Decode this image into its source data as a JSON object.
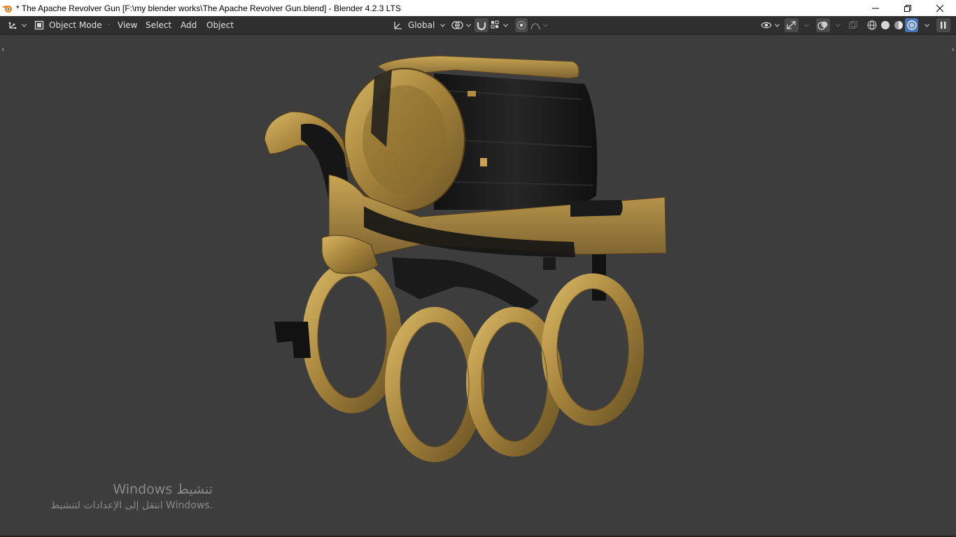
{
  "window": {
    "title": "* The Apache Revolver Gun [F:\\my blender works\\The Apache Revolver Gun.blend] - Blender 4.2.3 LTS",
    "app_icon": "blender-icon",
    "controls": [
      "minimize-icon",
      "restore-icon",
      "close-icon"
    ]
  },
  "header": {
    "editor_type_icon": "3d-viewport-icon",
    "mode": {
      "icon": "object-mode-icon",
      "label": "Object Mode"
    },
    "menus": [
      "View",
      "Select",
      "Add",
      "Object"
    ],
    "transform_orientation": {
      "icon": "global-orientation-icon",
      "label": "Global"
    },
    "pivot_icon": "pivot-point-icon",
    "snap_icon": "snap-magnet-icon",
    "snap_target_icon": "snap-increment-icon",
    "proportional_icon": "proportional-editing-icon",
    "falloff_icon": "falloff-curve-icon",
    "visibility_icon": "selectability-eye-icon",
    "gizmo_icon": "gizmo-icon",
    "overlay_icon": "overlay-icon",
    "xray_icon": "xray-icon",
    "shading_modes": [
      {
        "icon": "wireframe-shading-icon",
        "active": false
      },
      {
        "icon": "solid-shading-icon",
        "active": false
      },
      {
        "icon": "material-preview-icon",
        "active": false
      },
      {
        "icon": "rendered-shading-icon",
        "active": true
      }
    ],
    "sidebar_toggle_icon": "sidebar-toggle-icon"
  },
  "viewport": {
    "model_name": "",
    "watermark": {
      "line1": "Windows تنشيط",
      "line2": "انتقل إلى الإعدادات لتنشيط Windows."
    }
  },
  "colors": {
    "accent": "#4772b3",
    "header_bg": "#2f2f2f",
    "viewport_bg": "#3d3d3d",
    "brass": "#b8963e",
    "gunmetal": "#1a1a1a"
  }
}
